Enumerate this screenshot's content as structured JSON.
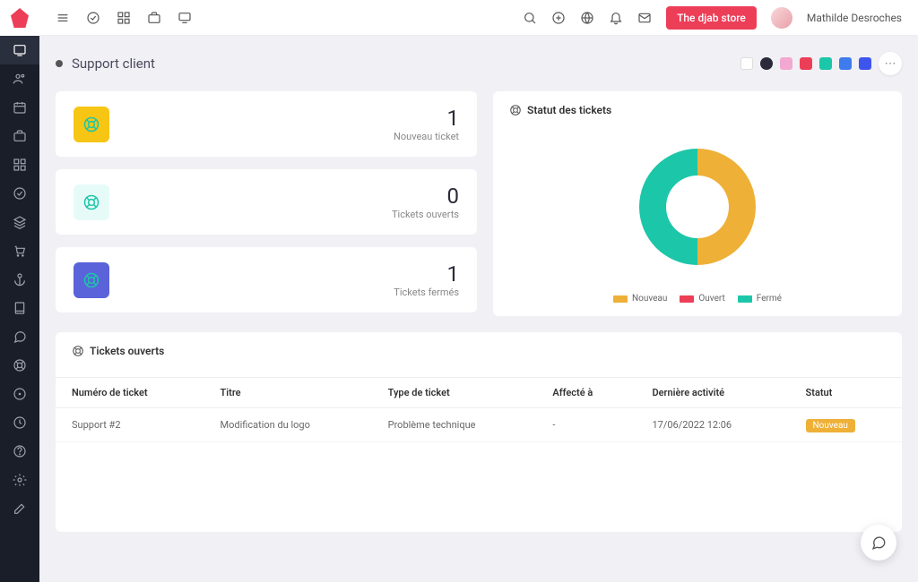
{
  "header": {
    "store_button": "The djab store",
    "username": "Mathilde Desroches"
  },
  "page": {
    "title": "Support client"
  },
  "theme_colors": [
    "#ffffff",
    "#2a2a3a",
    "#f2a8d0",
    "#ed3e58",
    "#1cc6a9",
    "#3e7bed",
    "#3e55ed"
  ],
  "stats": [
    {
      "label": "Nouveau ticket",
      "value": "1",
      "icon_bg": "#f7c514",
      "icon_stroke": "#1cc6a9"
    },
    {
      "label": "Tickets ouverts",
      "value": "0",
      "icon_bg": "#e6fbf8",
      "icon_stroke": "#1cc6a9"
    },
    {
      "label": "Tickets fermés",
      "value": "1",
      "icon_bg": "#5a63d9",
      "icon_stroke": "#1cc6a9"
    }
  ],
  "chart": {
    "title": "Statut des tickets",
    "legend": [
      {
        "label": "Nouveau",
        "color": "#eeb036"
      },
      {
        "label": "Ouvert",
        "color": "#ed3e58"
      },
      {
        "label": "Fermé",
        "color": "#1cc6a9"
      }
    ]
  },
  "chart_data": {
    "type": "pie",
    "title": "Statut des tickets",
    "series": [
      {
        "name": "Nouveau",
        "value": 1,
        "color": "#eeb036"
      },
      {
        "name": "Ouvert",
        "value": 0,
        "color": "#ed3e58"
      },
      {
        "name": "Fermé",
        "value": 1,
        "color": "#1cc6a9"
      }
    ]
  },
  "tickets_table": {
    "title": "Tickets ouverts",
    "columns": [
      "Numéro de ticket",
      "Titre",
      "Type de ticket",
      "Affecté à",
      "Dernière activité",
      "Statut"
    ],
    "rows": [
      {
        "num": "Support #2",
        "titre": "Modification du logo",
        "type": "Problème technique",
        "assignee": "-",
        "activity": "17/06/2022 12:06",
        "status": "Nouveau"
      }
    ]
  }
}
